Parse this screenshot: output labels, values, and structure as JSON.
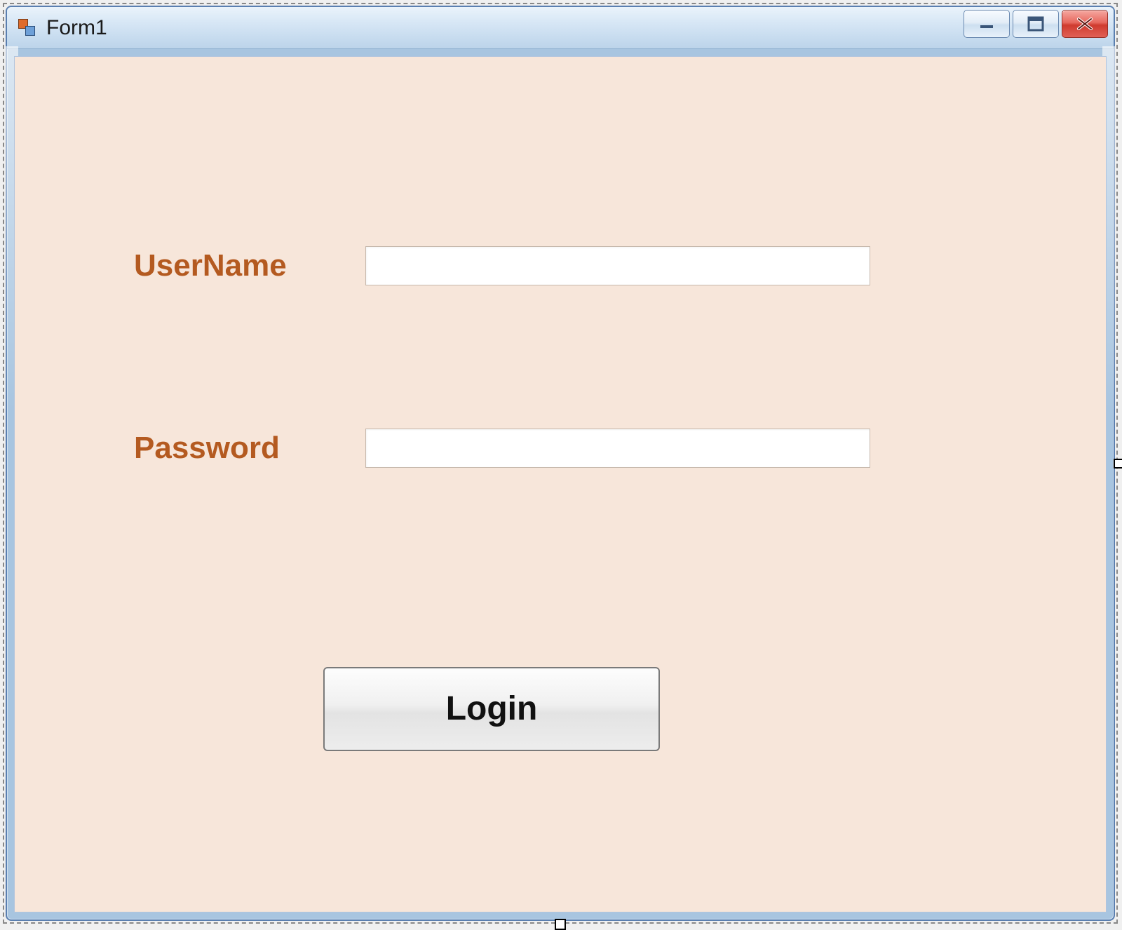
{
  "window": {
    "title": "Form1"
  },
  "fields": {
    "username_label": "UserName",
    "username_value": "",
    "password_label": "Password",
    "password_value": ""
  },
  "buttons": {
    "login_label": "Login"
  },
  "icons": {
    "form_icon": "winforms-default-icon",
    "minimize": "minimize-icon",
    "maximize": "maximize-icon",
    "close": "close-icon"
  }
}
